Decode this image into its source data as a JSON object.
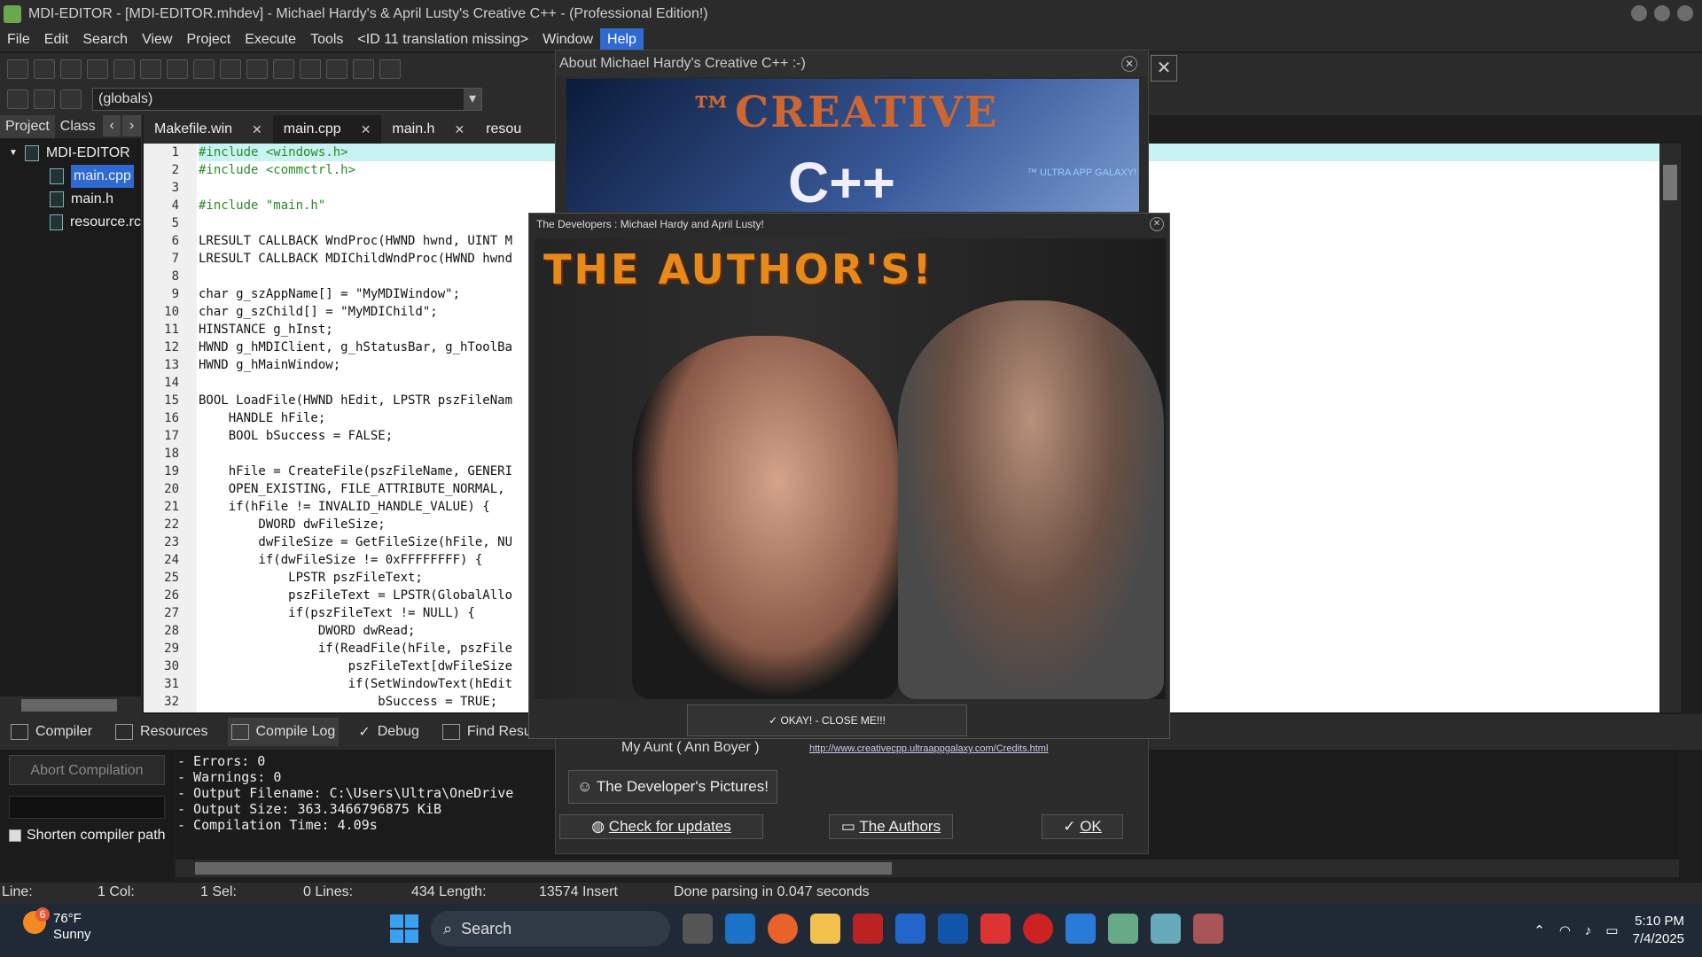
{
  "window": {
    "title": "MDI-EDITOR - [MDI-EDITOR.mhdev] - Michael Hardy's & April Lusty's  Creative C++ -  (Professional Edition!)"
  },
  "menu": [
    "File",
    "Edit",
    "Search",
    "View",
    "Project",
    "Execute",
    "Tools",
    "<ID 11 translation missing>",
    "Window",
    "Help"
  ],
  "globals": "(globals)",
  "panel": {
    "tabs": [
      "Project",
      "Class"
    ],
    "tree": [
      "MDI-EDITOR",
      "main.cpp",
      "main.h",
      "resource.rc"
    ]
  },
  "file_tabs": [
    "Makefile.win",
    "main.cpp",
    "main.h",
    "resou"
  ],
  "code": {
    "lines": [
      "#include <windows.h>",
      "#include <commctrl.h>",
      "",
      "#include \"main.h\"",
      "",
      "LRESULT CALLBACK WndProc(HWND hwnd, UINT M",
      "LRESULT CALLBACK MDIChildWndProc(HWND hwnd",
      "",
      "char g_szAppName[] = \"MyMDIWindow\";",
      "char g_szChild[] = \"MyMDIChild\";",
      "HINSTANCE g_hInst;",
      "HWND g_hMDIClient, g_hStatusBar, g_hToolBa",
      "HWND g_hMainWindow;",
      "",
      "BOOL LoadFile(HWND hEdit, LPSTR pszFileNam",
      "    HANDLE hFile;",
      "    BOOL bSuccess = FALSE;",
      "",
      "    hFile = CreateFile(pszFileName, GENERI",
      "    OPEN_EXISTING, FILE_ATTRIBUTE_NORMAL, ",
      "    if(hFile != INVALID_HANDLE_VALUE) {",
      "        DWORD dwFileSize;",
      "        dwFileSize = GetFileSize(hFile, NU",
      "        if(dwFileSize != 0xFFFFFFFF) {",
      "            LPSTR pszFileText;",
      "            pszFileText = LPSTR(GlobalAllo",
      "            if(pszFileText != NULL) {",
      "                DWORD dwRead;",
      "                if(ReadFile(hFile, pszFile",
      "                    pszFileText[dwFileSize",
      "                    if(SetWindowText(hEdit",
      "                        bSuccess = TRUE;"
    ]
  },
  "bottom_tabs": [
    "Compiler",
    "Resources",
    "Compile Log",
    "Debug",
    "Find Results"
  ],
  "compile": {
    "abort": "Abort Compilation",
    "shorten": "Shorten compiler path",
    "log": [
      "- Errors: 0",
      "- Warnings: 0",
      "- Output Filename: C:\\Users\\Ultra\\OneDrive",
      "- Output Size: 363.3466796875 KiB",
      "- Compilation Time: 4.09s"
    ]
  },
  "status": {
    "line": "Line:",
    "col": "1 Col:",
    "sel": "1 Sel:",
    "lines": "0 Lines:",
    "length": "434 Length:",
    "insert": "13574  Insert",
    "parse": "Done parsing in 0.047 seconds"
  },
  "about": {
    "title": "About Michael Hardy's Creative C++ :-)",
    "banner_tm": "™CREATIVE",
    "banner_cpp": "C++",
    "banner_ua": "™ ULTRA APP GALAXY!",
    "aunt": "My Aunt ( Ann Boyer )",
    "link": "http://www.creativecpp.ultraappgalaxy.com/Credits.html",
    "dev_pictures": "The Developer's Pictures!",
    "check_updates": "Check for updates",
    "the_authors": "The Authors",
    "ok": "OK"
  },
  "devs": {
    "title": "The Developers : Michael Hardy and April Lusty!",
    "banner": "THE AUTHOR'S!",
    "close": "OKAY! - CLOSE ME!!!"
  },
  "taskbar": {
    "temp": "76°F",
    "weather": "Sunny",
    "badge": "6",
    "search": "Search",
    "time": "5:10 PM",
    "date": "7/4/2025"
  }
}
